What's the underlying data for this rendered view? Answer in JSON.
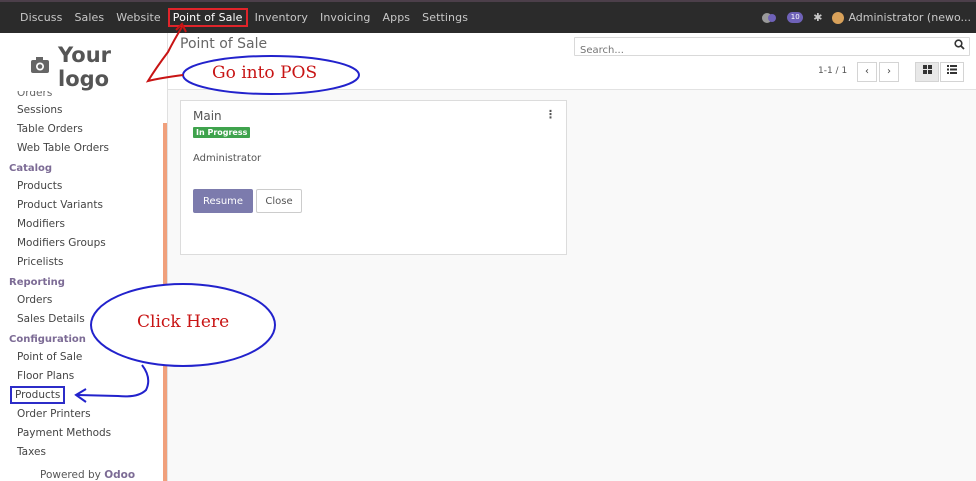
{
  "topbar": {
    "menu": [
      "Discuss",
      "Sales",
      "Website",
      "Point of Sale",
      "Inventory",
      "Invoicing",
      "Apps",
      "Settings"
    ],
    "active_index": 3,
    "chat_badge": "",
    "activity_badge": "10",
    "user": "Administrator (newo..."
  },
  "sidebar": {
    "logo_text": "Your logo",
    "items_partial": "Orders",
    "items": [
      {
        "type": "item",
        "label": "Sessions"
      },
      {
        "type": "item",
        "label": "Table Orders"
      },
      {
        "type": "item",
        "label": "Web Table Orders"
      },
      {
        "type": "section",
        "label": "Catalog"
      },
      {
        "type": "item",
        "label": "Products"
      },
      {
        "type": "item",
        "label": "Product Variants"
      },
      {
        "type": "item",
        "label": "Modifiers"
      },
      {
        "type": "item",
        "label": "Modifiers Groups"
      },
      {
        "type": "item",
        "label": "Pricelists"
      },
      {
        "type": "section",
        "label": "Reporting"
      },
      {
        "type": "item",
        "label": "Orders"
      },
      {
        "type": "item",
        "label": "Sales Details"
      },
      {
        "type": "section",
        "label": "Configuration"
      },
      {
        "type": "item",
        "label": "Point of Sale"
      },
      {
        "type": "item",
        "label": "Floor Plans"
      },
      {
        "type": "item",
        "label": "Products",
        "boxed": true
      },
      {
        "type": "item",
        "label": "Order Printers"
      },
      {
        "type": "item",
        "label": "Payment Methods"
      },
      {
        "type": "item",
        "label": "Taxes"
      }
    ],
    "powered_prefix": "Powered by",
    "powered_brand": "Odoo"
  },
  "control_panel": {
    "breadcrumb": "Point of Sale",
    "search_placeholder": "Search...",
    "pager": "1-1 / 1"
  },
  "card": {
    "name": "Main",
    "status": "In Progress",
    "user": "Administrator",
    "resume_label": "Resume",
    "close_label": "Close"
  },
  "annotations": {
    "top_callout": "Go into POS",
    "side_callout": "Click Here",
    "color": "#c81414",
    "line_color": "#2222cc"
  }
}
